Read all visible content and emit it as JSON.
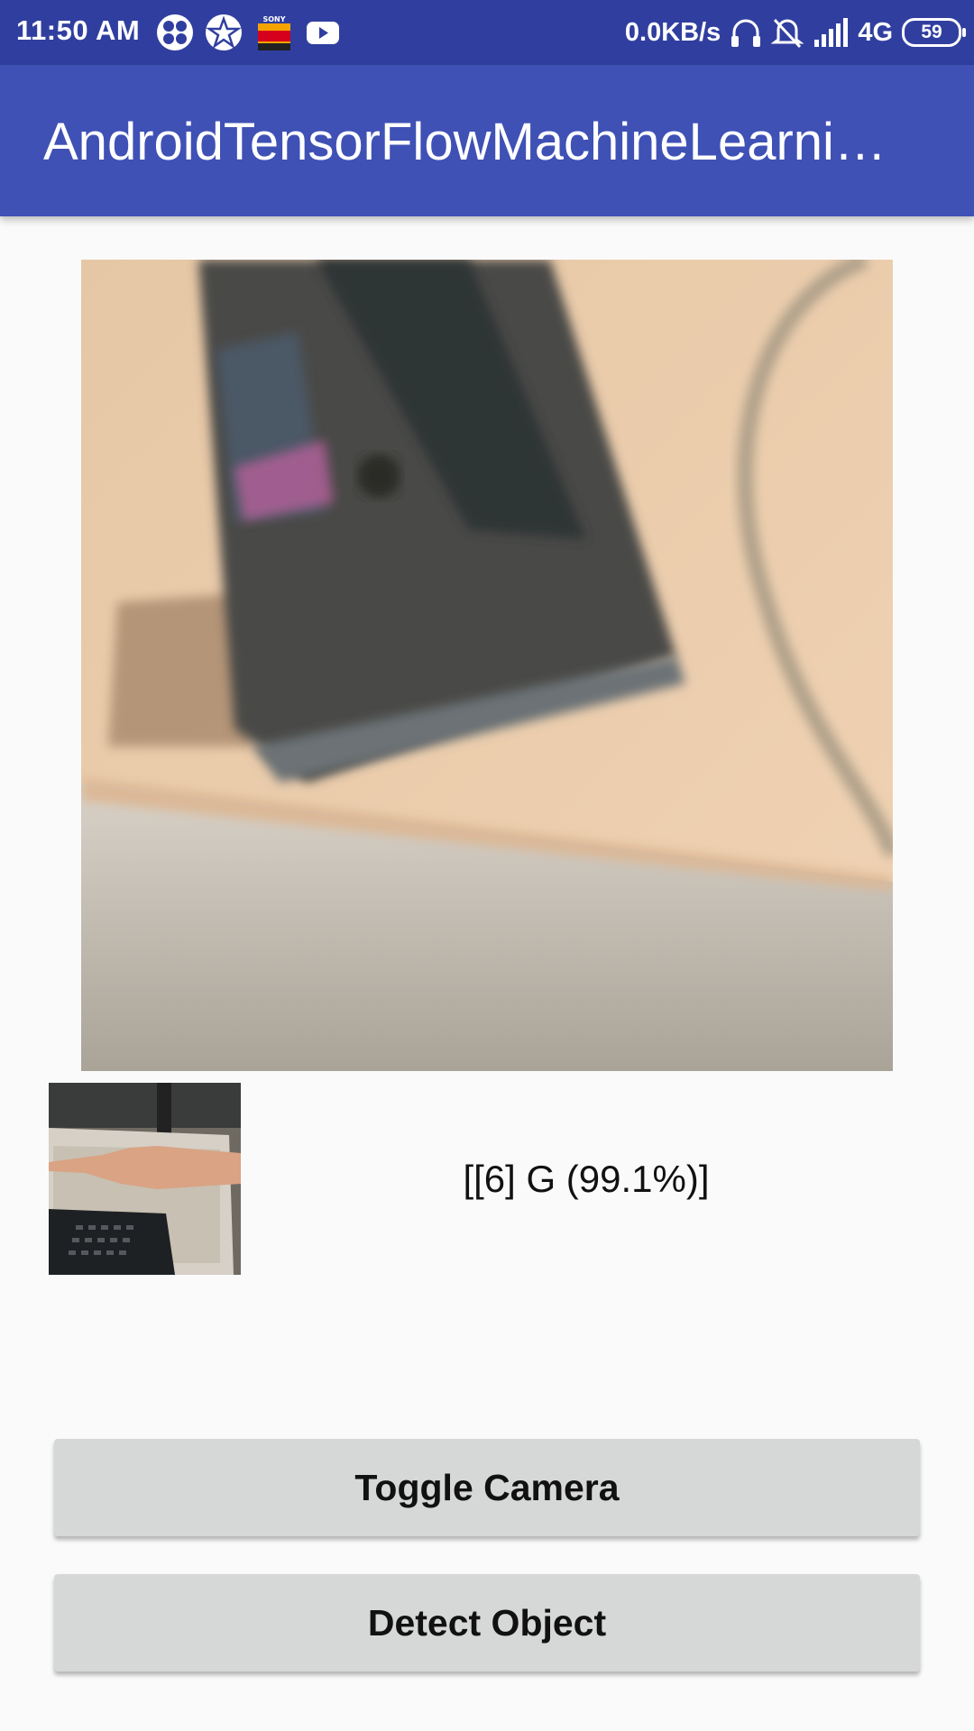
{
  "status_bar": {
    "time": "11:50 AM",
    "net_speed": "0.0KB/s",
    "network": "4G",
    "battery": "59",
    "icons": [
      "fan-app-icon",
      "star-app-icon",
      "sonyliv-icon",
      "youtube-icon",
      "headset-icon",
      "mute-bell-icon",
      "signal-icon",
      "battery-icon"
    ]
  },
  "app_bar": {
    "title": "AndroidTensorFlowMachineLearni…"
  },
  "camera_preview": {
    "description_icon": "camera-preview"
  },
  "result": {
    "text": "[[6] G (99.1%)]"
  },
  "buttons": {
    "toggle_camera": "Toggle Camera",
    "detect_object": "Detect Object"
  },
  "colors": {
    "status_bar": "#303f9f",
    "app_bar": "#3f51b5",
    "button": "#d6d7d7",
    "background": "#fafafa"
  }
}
